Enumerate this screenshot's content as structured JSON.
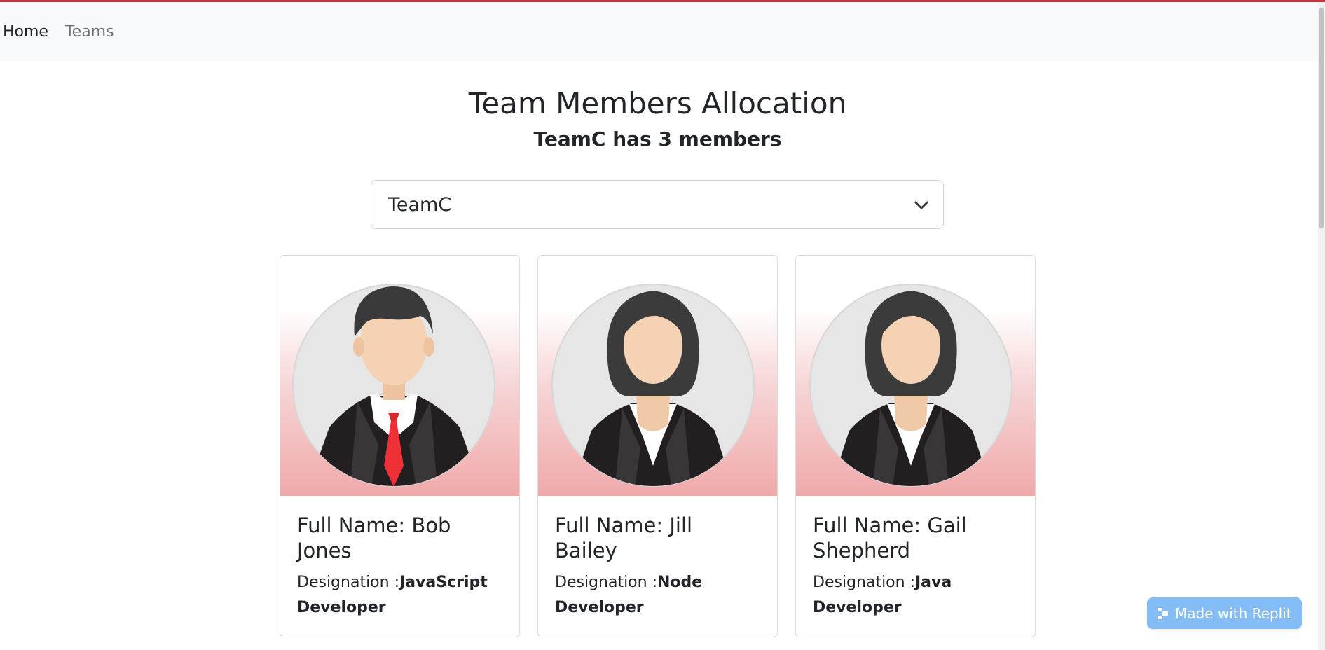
{
  "nav": {
    "home_label": "Home",
    "teams_label": "Teams"
  },
  "header": {
    "title": "Team Members Allocation",
    "subtitle": "TeamC has 3 members"
  },
  "team_select": {
    "selected": "TeamC"
  },
  "members": [
    {
      "full_name": "Full Name: Bob Jones",
      "designation_label": "Designation :",
      "designation": "JavaScript Developer",
      "avatar": "male-avatar-icon"
    },
    {
      "full_name": "Full Name: Jill Bailey",
      "designation_label": "Designation :",
      "designation": "Node Developer",
      "avatar": "female-avatar-icon"
    },
    {
      "full_name": "Full Name: Gail Shepherd",
      "designation_label": "Designation :",
      "designation": "Java Developer",
      "avatar": "female-avatar-icon"
    }
  ],
  "badge": {
    "label": "Made with Replit"
  },
  "colors": {
    "accent": "#c8343d",
    "badge": "#84bdf5",
    "card_gradient_end": "#f0a9aa"
  }
}
